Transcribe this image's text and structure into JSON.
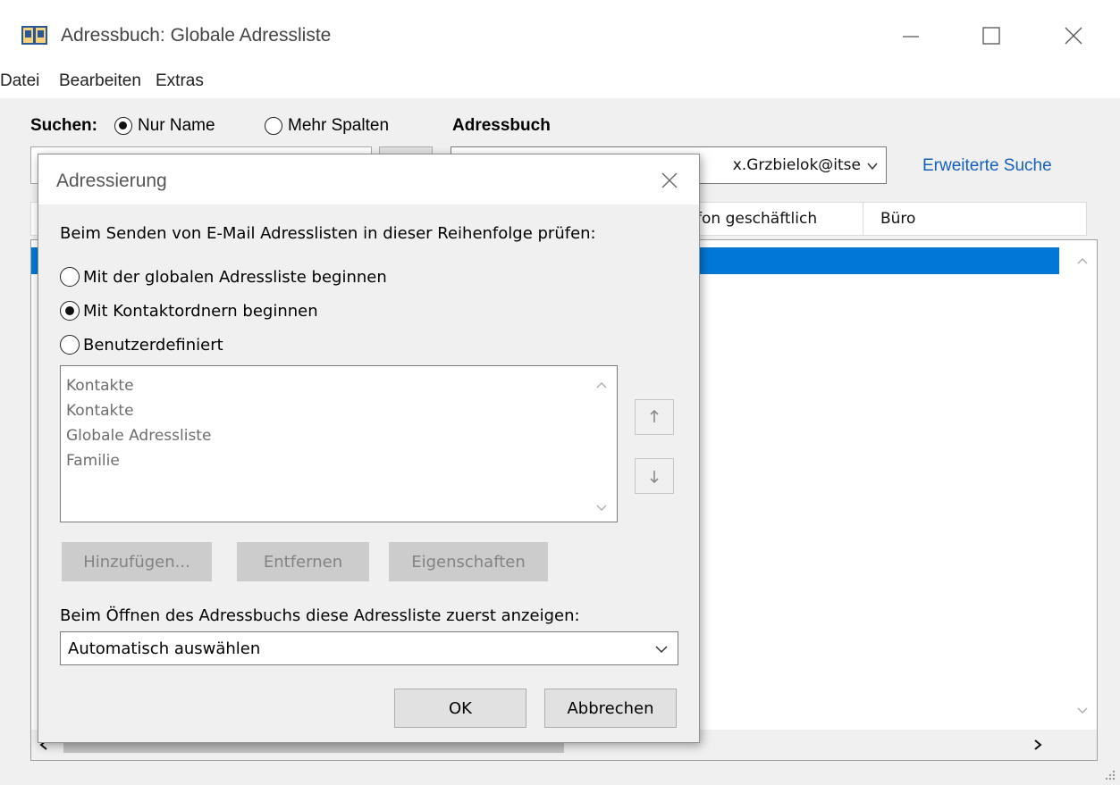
{
  "window": {
    "title": "Adressbuch: Globale Adressliste",
    "menu": [
      "Datei",
      "Bearbeiten",
      "Extras"
    ]
  },
  "search": {
    "label": "Suchen:",
    "option_name_only": "Nur Name",
    "option_more_columns": "Mehr Spalten",
    "address_book_label": "Adressbuch",
    "address_book_value": "x.Grzbielok@itse",
    "advanced_search_link": "Erweiterte Suche",
    "selected_option": "Nur Name"
  },
  "columns": {
    "visible_headers": [
      "fon geschäftlich",
      "Büro"
    ]
  },
  "dialog": {
    "title": "Adressierung",
    "check_order_label": "Beim Senden von E-Mail Adresslisten in dieser Reihenfolge prüfen:",
    "options": [
      {
        "label": "Mit der globalen Adressliste beginnen",
        "selected": false
      },
      {
        "label": "Mit Kontaktordnern beginnen",
        "selected": true
      },
      {
        "label": "Benutzerdefiniert",
        "selected": false
      }
    ],
    "lists": [
      "Kontakte",
      "Kontakte",
      "Globale Adressliste",
      "Familie"
    ],
    "buttons": {
      "add": "Hinzufügen...",
      "remove": "Entfernen",
      "properties": "Eigenschaften",
      "ok": "OK",
      "cancel": "Abbrechen"
    },
    "open_label": "Beim Öffnen des Adressbuchs diese Adressliste zuerst anzeigen:",
    "open_value": "Automatisch auswählen"
  },
  "colors": {
    "selection": "#0078d7",
    "link": "#1560bd",
    "dialog_bg": "#f0f0f0"
  }
}
